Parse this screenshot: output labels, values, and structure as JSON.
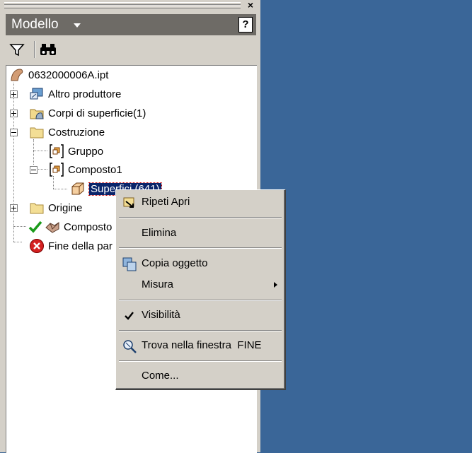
{
  "panel": {
    "title": "Modello",
    "close_glyph": "×",
    "help_glyph": "?",
    "toolbar": [
      {
        "icon": "filter-icon"
      },
      {
        "icon": "binoculars-icon"
      }
    ]
  },
  "tree": {
    "root": {
      "label": "0632000006A.ipt",
      "icon": "part-icon"
    },
    "nodes": [
      {
        "label": "Altro produttore",
        "icon": "third-party-icon"
      },
      {
        "label": "Corpi di superficie(1)",
        "icon": "surface-bodies-folder-icon"
      },
      {
        "label": "Costruzione",
        "icon": "folder-icon"
      },
      {
        "label": "Gruppo",
        "icon": "group-icon"
      },
      {
        "label": "Composto1",
        "icon": "composite-icon"
      },
      {
        "label": "Superfici (641)",
        "icon": "surface-icon"
      },
      {
        "label": "Origine",
        "icon": "folder-icon"
      },
      {
        "label": "Composto",
        "icon": "composite-feature-icon"
      },
      {
        "label": "Fine della par",
        "icon": "end-of-part-icon"
      }
    ]
  },
  "context_menu": {
    "items": [
      {
        "label": "Ripeti Apri",
        "icon": "repeat-icon"
      },
      {
        "label": "Elimina"
      },
      {
        "label": "Copia oggetto",
        "icon": "copy-object-icon"
      },
      {
        "label": "Misura",
        "has_submenu": true
      },
      {
        "label": "Visibilità",
        "checked": true
      },
      {
        "label": "Trova nella finestra",
        "shortcut": "FINE",
        "icon": "find-in-window-icon"
      },
      {
        "label": "Come..."
      }
    ]
  },
  "colors": {
    "desktop": "#3a6698",
    "panel_title_bg": "#6e6b66",
    "selection": "#0a246a"
  }
}
